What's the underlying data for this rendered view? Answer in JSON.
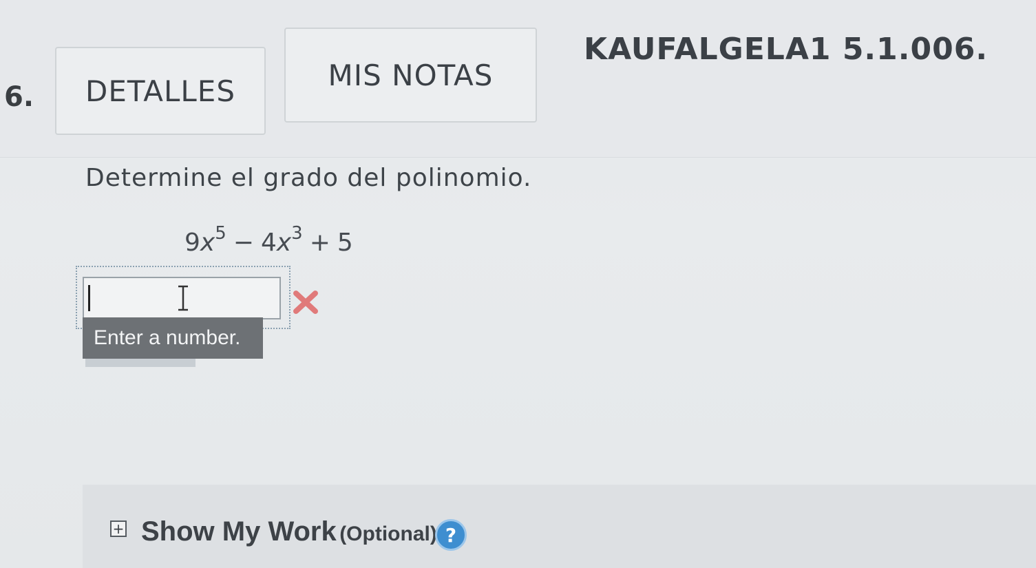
{
  "question": {
    "number": "6.",
    "code": "KAUFALGELA1 5.1.006."
  },
  "buttons": {
    "details": "DETALLES",
    "notes": "MIS NOTAS"
  },
  "prompt": "Determine el grado del polinomio.",
  "polynomial": {
    "term1_coef": "9",
    "term1_var": "x",
    "term1_exp": "5",
    "op1": "−",
    "term2_coef": "4",
    "term2_var": "x",
    "term2_exp": "3",
    "op2": "+",
    "term3": "5"
  },
  "answer": {
    "value": "",
    "status": "incorrect",
    "tooltip": "Enter a number."
  },
  "show_work": {
    "label": "Show My Work",
    "optional": "(Optional)",
    "expand_glyph": "+",
    "help_glyph": "?"
  },
  "colors": {
    "incorrect": "#e07a7a",
    "help": "#3e8ed0",
    "tooltip_bg": "#6d7175"
  },
  "icons": [
    "incorrect-x-icon",
    "expand-plus-icon",
    "help-icon",
    "text-cursor-icon"
  ]
}
